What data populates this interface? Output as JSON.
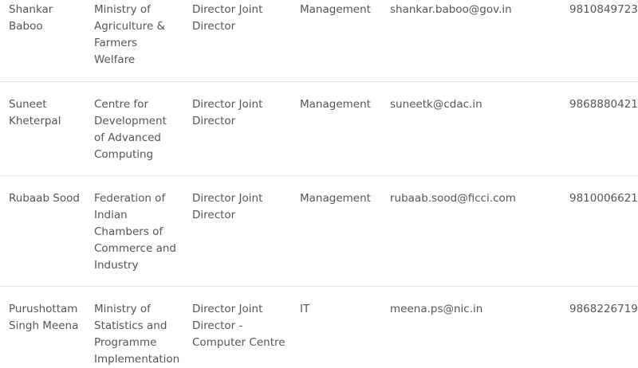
{
  "rows": [
    {
      "name": "Shankar Baboo",
      "organization": "Ministry of Agriculture & Farmers Welfare",
      "designation": "Director Joint Director",
      "department": "Management",
      "email": "shankar.baboo@gov.in",
      "phone": "9810849723"
    },
    {
      "name": "Suneet Kheterpal",
      "organization": "Centre for Development of Advanced Computing",
      "designation": "Director Joint Director",
      "department": "Management",
      "email": "suneetk@cdac.in",
      "phone": "9868880421"
    },
    {
      "name": "Rubaab Sood",
      "organization": "Federation of Indian Chambers of Commerce and Industry",
      "designation": "Director Joint Director",
      "department": "Management",
      "email": "rubaab.sood@ficci.com",
      "phone": "9810006621"
    },
    {
      "name": "Purushottam Singh Meena",
      "organization": "Ministry of Statistics and Programme Implementation",
      "designation": "Director Joint Director - Computer Centre",
      "department": "IT",
      "email": "meena.ps@nic.in",
      "phone": "9868226719"
    }
  ]
}
